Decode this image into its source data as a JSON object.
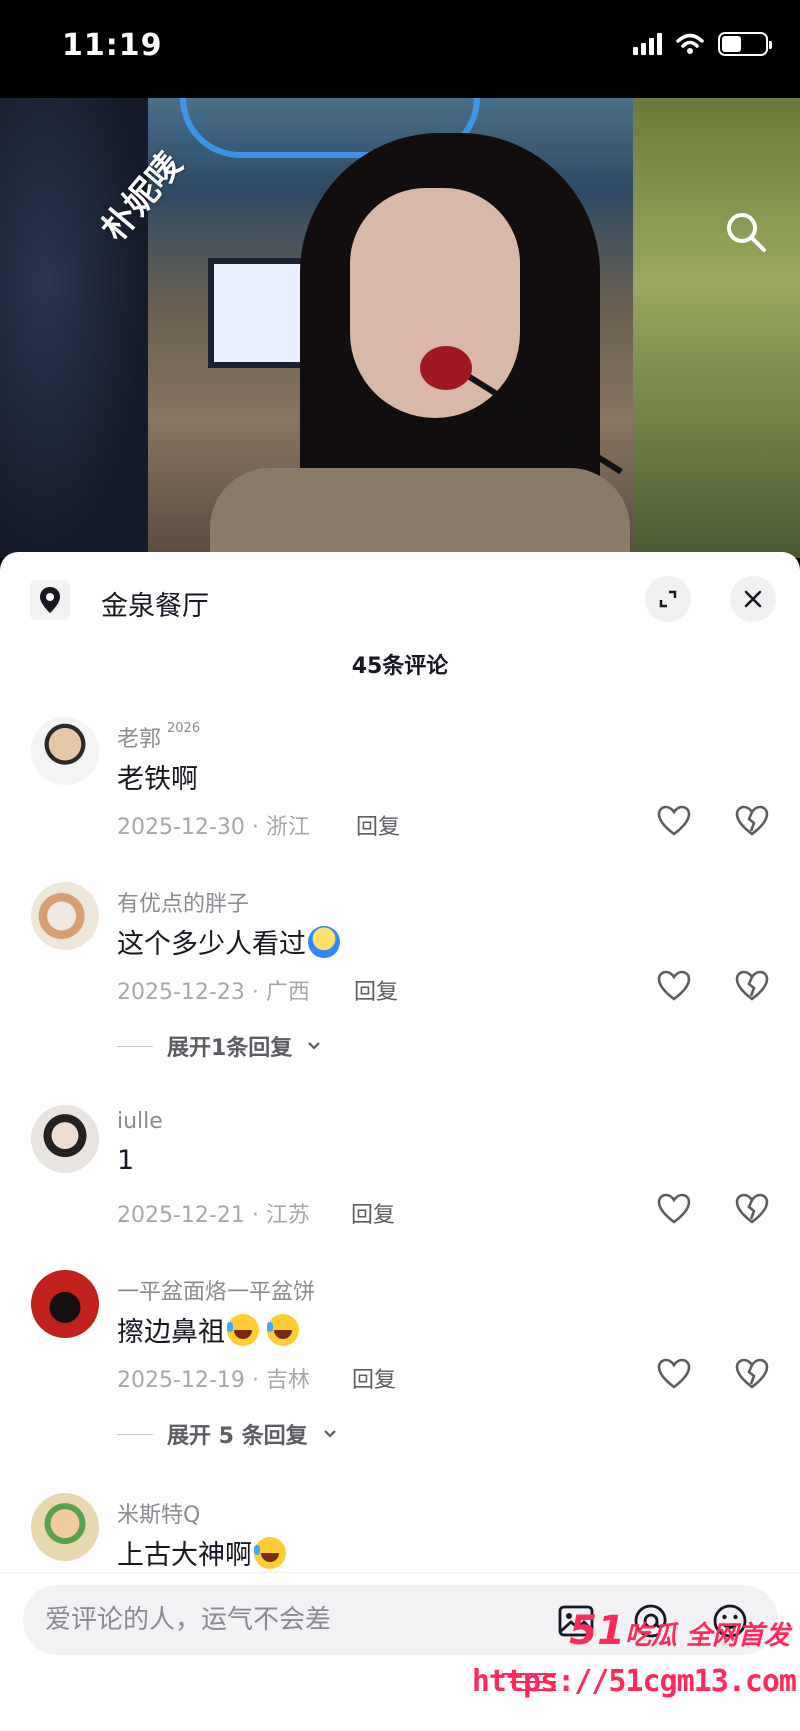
{
  "status_bar": {
    "time": "11:19"
  },
  "video": {
    "watermark_name": "朴妮唛"
  },
  "sheet": {
    "location_name": "金泉餐厅",
    "comment_count": "45条评论"
  },
  "comments": [
    {
      "name": "老郭",
      "badge": "2026",
      "text": "老铁啊",
      "meta": "2025-12-30 · 浙江",
      "reply": "回复"
    },
    {
      "name": "有优点的胖子",
      "text": "这个多少人看过",
      "meta": "2025-12-23 · 广西",
      "reply": "回复",
      "expand": "展开1条回复"
    },
    {
      "name": "iulle",
      "text": "1",
      "meta": "2025-12-21 · 江苏",
      "reply": "回复"
    },
    {
      "name": "一平盆面烙一平盆饼",
      "text": "擦边鼻祖",
      "meta": "2025-12-19 · 吉林",
      "reply": "回复",
      "expand": "展开 5 条回复"
    },
    {
      "name": "米斯特Q",
      "text": "上古大神啊"
    }
  ],
  "input": {
    "placeholder": "爱评论的人，运气不会差"
  },
  "site_watermark": {
    "brand_num": "51",
    "brand_text": "吃瓜 全网首发",
    "url": "https://51cgm13.com"
  },
  "colors": {
    "accent": "#ff2a5a",
    "text_primary": "#161823",
    "text_secondary": "#8a8b91"
  },
  "icons": [
    "location-pin-icon",
    "expand-icon",
    "close-icon",
    "heart-icon",
    "broken-heart-icon",
    "image-icon",
    "at-icon",
    "emoji-icon",
    "search-icon"
  ]
}
